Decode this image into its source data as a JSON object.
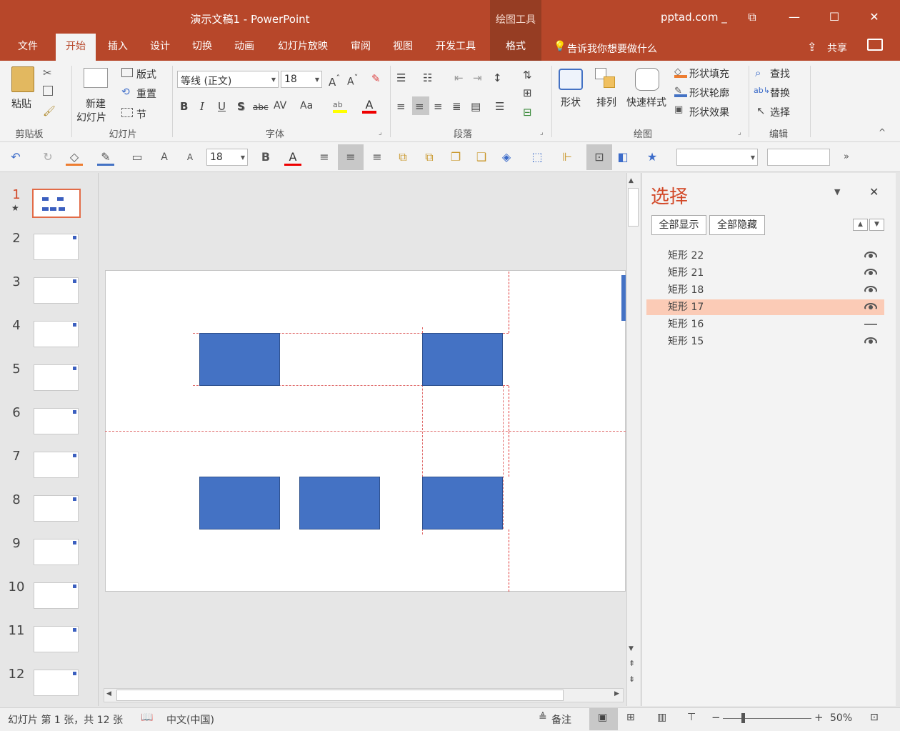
{
  "titlebar": {
    "title": "演示文稿1  -  PowerPoint",
    "context_tab_group": "绘图工具",
    "account": "pptad.com _"
  },
  "tabs": [
    "文件",
    "开始",
    "插入",
    "设计",
    "切换",
    "动画",
    "幻灯片放映",
    "审阅",
    "视图",
    "开发工具",
    "格式"
  ],
  "active_tab": "开始",
  "tell_me": "告诉我你想要做什么",
  "share": "共享",
  "ribbon": {
    "clipboard": {
      "paste": "粘贴",
      "label": "剪贴板"
    },
    "slides": {
      "new_slide_1": "新建",
      "new_slide_2": "幻灯片",
      "layout": "版式",
      "reset": "重置",
      "section": "节",
      "label": "幻灯片"
    },
    "font": {
      "font_name": "等线 (正文)",
      "font_size": "18",
      "label": "字体",
      "bold": "B",
      "italic": "I",
      "underline": "U",
      "shadow": "S",
      "strike": "abc",
      "spacing": "AV",
      "case": "Aa",
      "color_a": "A"
    },
    "paragraph": {
      "label": "段落"
    },
    "drawing": {
      "shapes": "形状",
      "arrange": "排列",
      "quick_styles": "快速样式",
      "fill": "形状填充",
      "outline": "形状轮廓",
      "effects": "形状效果",
      "label": "绘图"
    },
    "editing": {
      "find": "查找",
      "replace": "替换",
      "select": "选择",
      "label": "编辑"
    }
  },
  "qat": {
    "font_size": "18"
  },
  "thumbnails": [
    "1",
    "2",
    "3",
    "4",
    "5",
    "6",
    "7",
    "8",
    "9",
    "10",
    "11",
    "12"
  ],
  "selection_pane": {
    "title": "选择",
    "show_all": "全部显示",
    "hide_all": "全部隐藏",
    "items": [
      {
        "name": "矩形 22",
        "visible": true
      },
      {
        "name": "矩形 21",
        "visible": true
      },
      {
        "name": "矩形 18",
        "visible": true
      },
      {
        "name": "矩形 17",
        "visible": true,
        "selected": true
      },
      {
        "name": "矩形 16",
        "visible": false
      },
      {
        "name": "矩形 15",
        "visible": true
      }
    ]
  },
  "status": {
    "slide_info": "幻灯片 第 1 张，共 12 张",
    "language": "中文(中国)",
    "notes": "备注",
    "zoom": "50%"
  },
  "colors": {
    "accent": "#b7472a",
    "shape_fill": "#4472c4",
    "selected_item": "#fbcbb6",
    "pane_title": "#d24726"
  }
}
